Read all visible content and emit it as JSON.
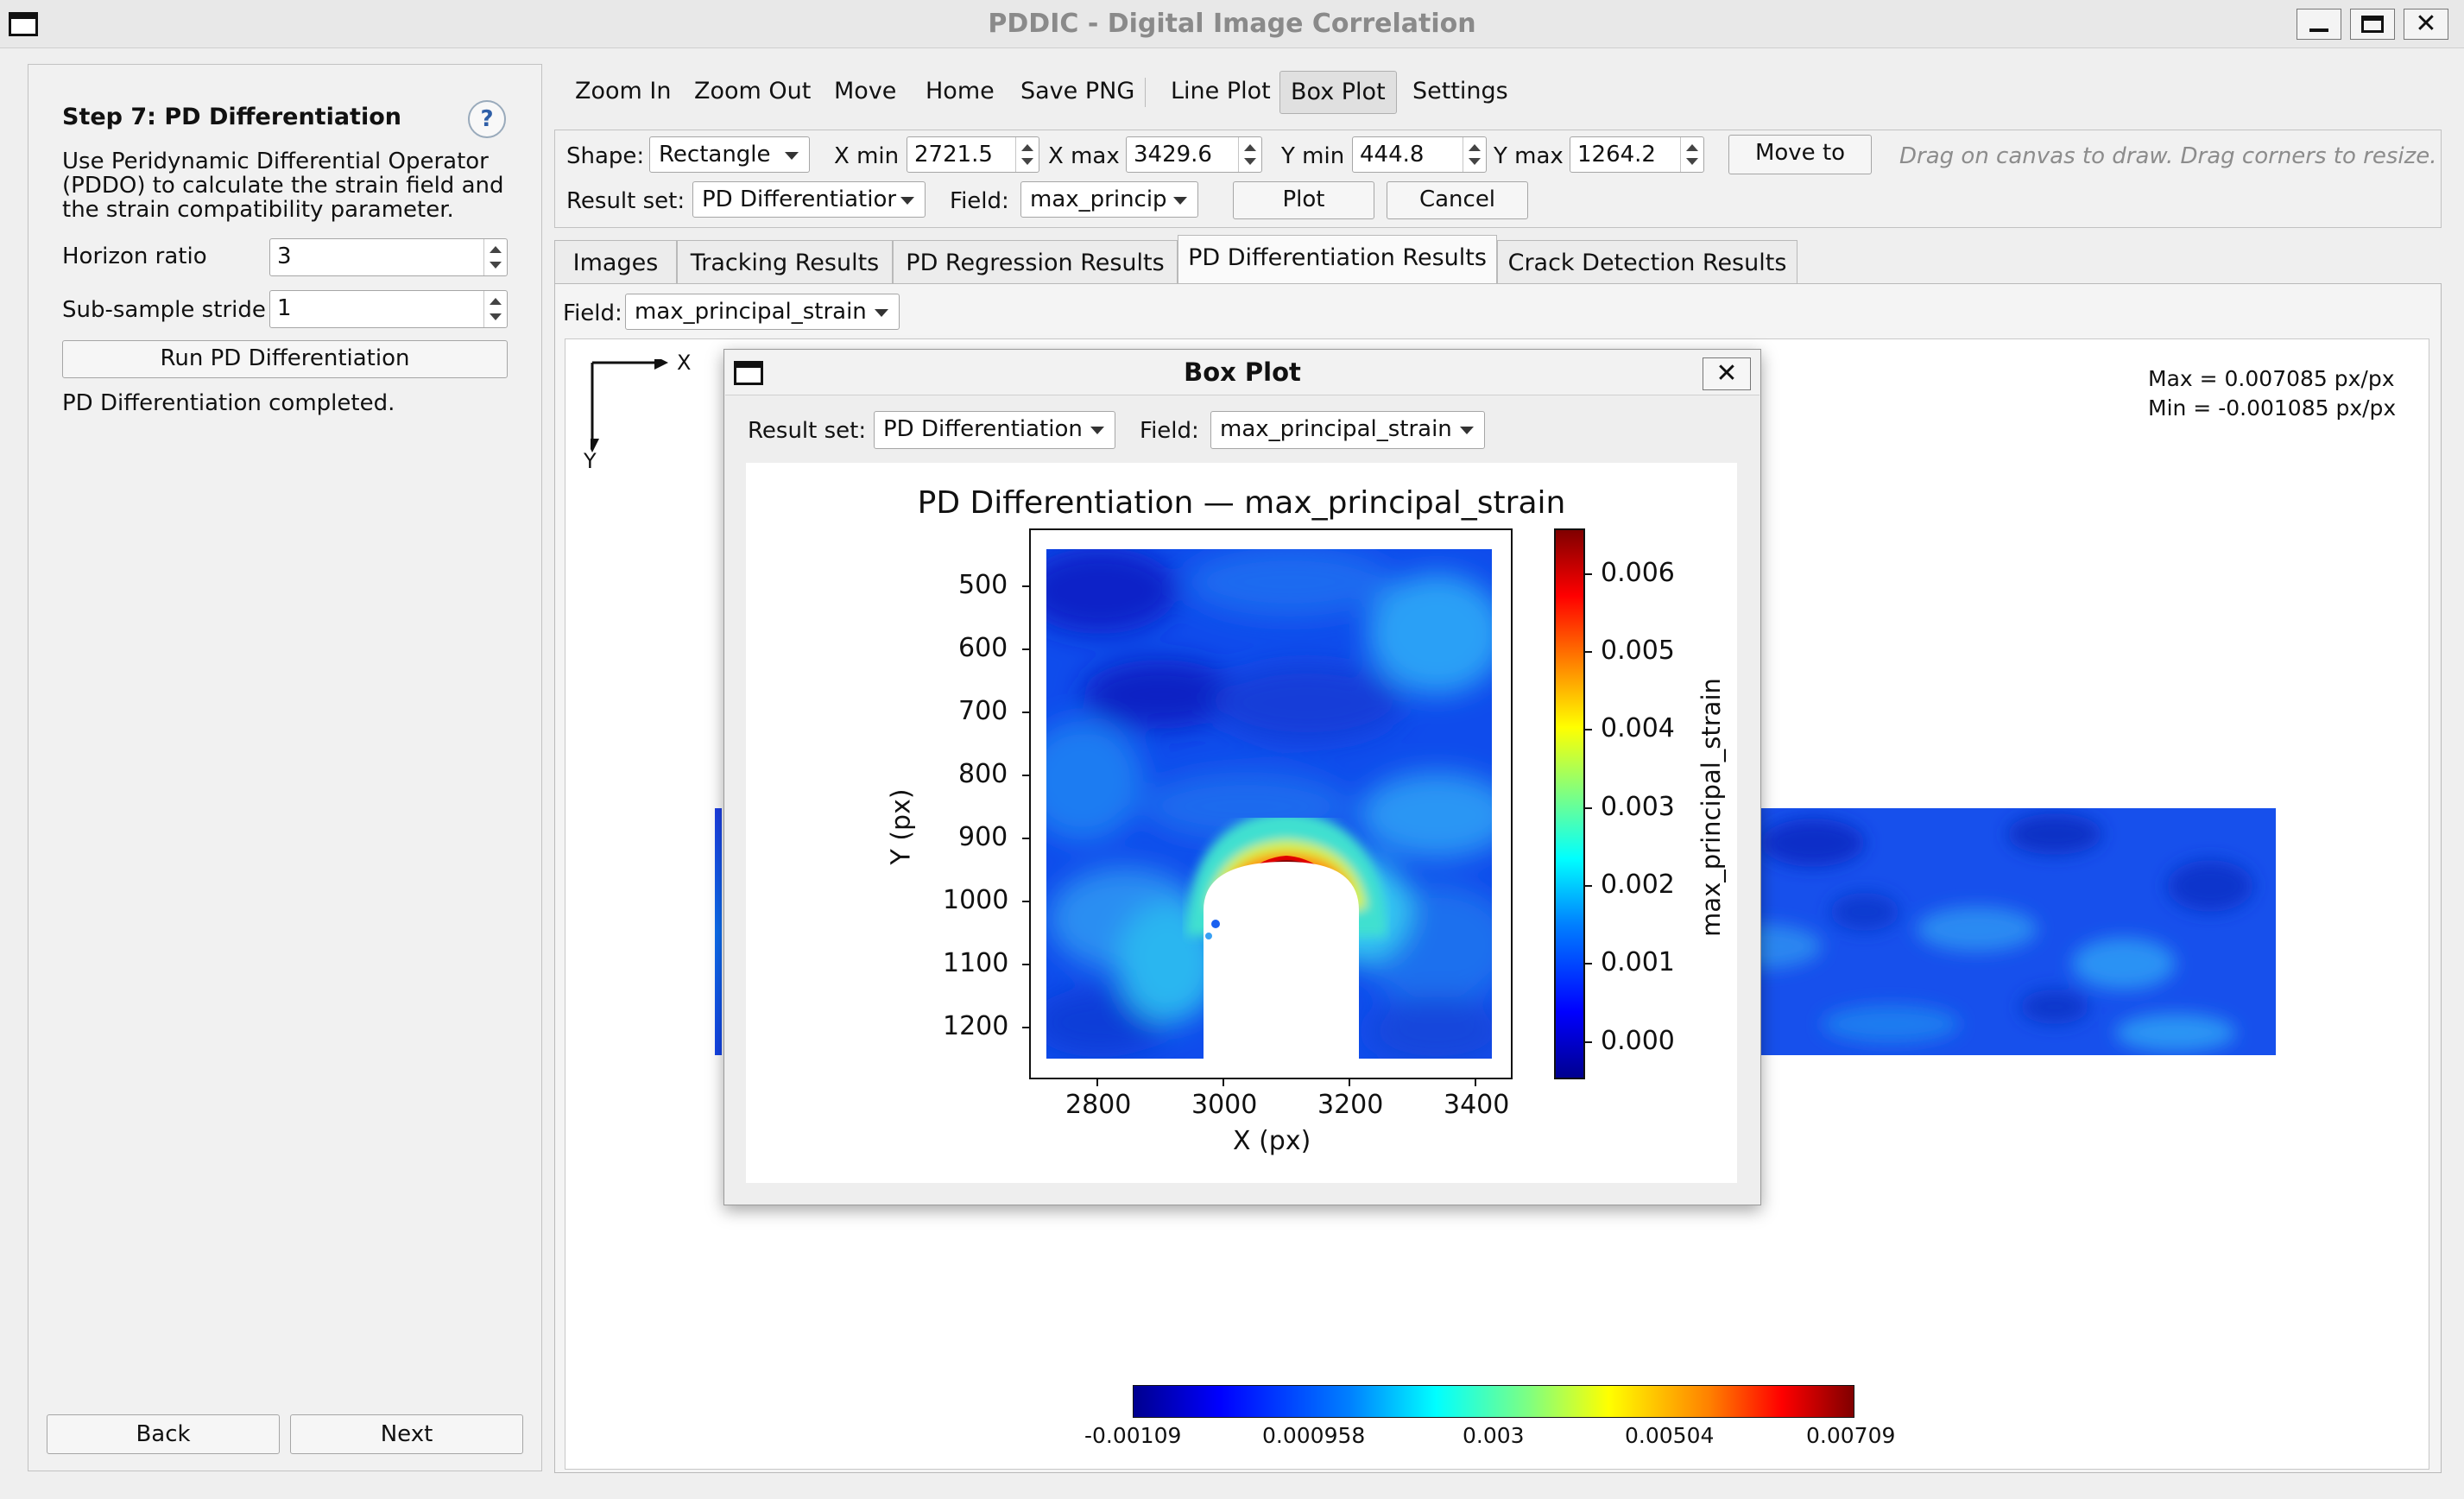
{
  "window": {
    "title": "PDDIC - Digital Image Correlation"
  },
  "step": {
    "title": "Step 7: PD Differentiation",
    "help_label": "?",
    "desc_line1": "Use Peridynamic Differential Operator",
    "desc_line2": "(PDDO) to calculate the strain field and",
    "desc_line3": "the strain compatibility parameter.",
    "horizon_label": "Horizon ratio",
    "horizon_value": "3",
    "stride_label": "Sub-sample stride",
    "stride_value": "1",
    "run_label": "Run PD Differentiation",
    "status": "PD Differentiation completed.",
    "back_label": "Back",
    "next_label": "Next"
  },
  "toolbar": {
    "zoom_in": "Zoom In",
    "zoom_out": "Zoom Out",
    "move": "Move",
    "home": "Home",
    "save_png": "Save PNG",
    "line_plot": "Line Plot",
    "box_plot": "Box Plot",
    "settings": "Settings"
  },
  "boxopts": {
    "shape_label": "Shape:",
    "shape_value": "Rectangle",
    "xmin_label": "X min",
    "xmin_value": "2721.5",
    "xmax_label": "X max",
    "xmax_value": "3429.6",
    "ymin_label": "Y min",
    "ymin_value": "444.8",
    "ymax_label": "Y max",
    "ymax_value": "1264.2",
    "move_to_label": "Move to",
    "hint": "Drag on canvas to draw.  Drag corners to resize.",
    "result_set_label": "Result set:",
    "result_set_value": "PD Differentiatior",
    "field_label": "Field:",
    "field_value": "max_princip",
    "plot_label": "Plot",
    "cancel_label": "Cancel"
  },
  "tabs": [
    "Images",
    "Tracking Results",
    "PD Regression Results",
    "PD Differentiation Results",
    "Crack Detection Results"
  ],
  "viewer": {
    "field_label": "Field:",
    "field_value": "max_principal_strain",
    "axis_x": "X",
    "axis_y": "Y",
    "max_text": "Max = 0.007085 px/px",
    "min_text": "Min = -0.001085 px/px",
    "colorbar_ticks": [
      "-0.00109",
      "0.000958",
      "0.003",
      "0.00504",
      "0.00709"
    ]
  },
  "dialog": {
    "title": "Box Plot",
    "result_set_label": "Result set:",
    "result_set_value": "PD Differentiation",
    "field_label": "Field:",
    "field_value": "max_principal_strain"
  },
  "chart_data": {
    "type": "heatmap",
    "title": "PD Differentiation  —  max_principal_strain",
    "xlabel": "X (px)",
    "ylabel": "Y (px)",
    "colorbar_label": "max_principal_strain",
    "x_ticks": [
      "2800",
      "3000",
      "3200",
      "3400"
    ],
    "y_ticks": [
      "500",
      "600",
      "700",
      "800",
      "900",
      "1000",
      "1100",
      "1200"
    ],
    "colorbar_ticks": [
      "0.000",
      "0.001",
      "0.002",
      "0.003",
      "0.004",
      "0.005",
      "0.006"
    ],
    "xlim": [
      2721.5,
      3429.6
    ],
    "ylim": [
      1264.2,
      444.8
    ],
    "clim": [
      -0.0007,
      0.0065
    ],
    "colormap": "jet",
    "hole": {
      "x_range": [
        2970,
        3190
      ],
      "top_y": 930
    },
    "peak_region": {
      "x": 3090,
      "y": 915,
      "value": 0.0064
    }
  },
  "colors": {
    "accent": "#2f5fa8",
    "hot": "#c00000",
    "field_low": "#0a3fe0"
  }
}
